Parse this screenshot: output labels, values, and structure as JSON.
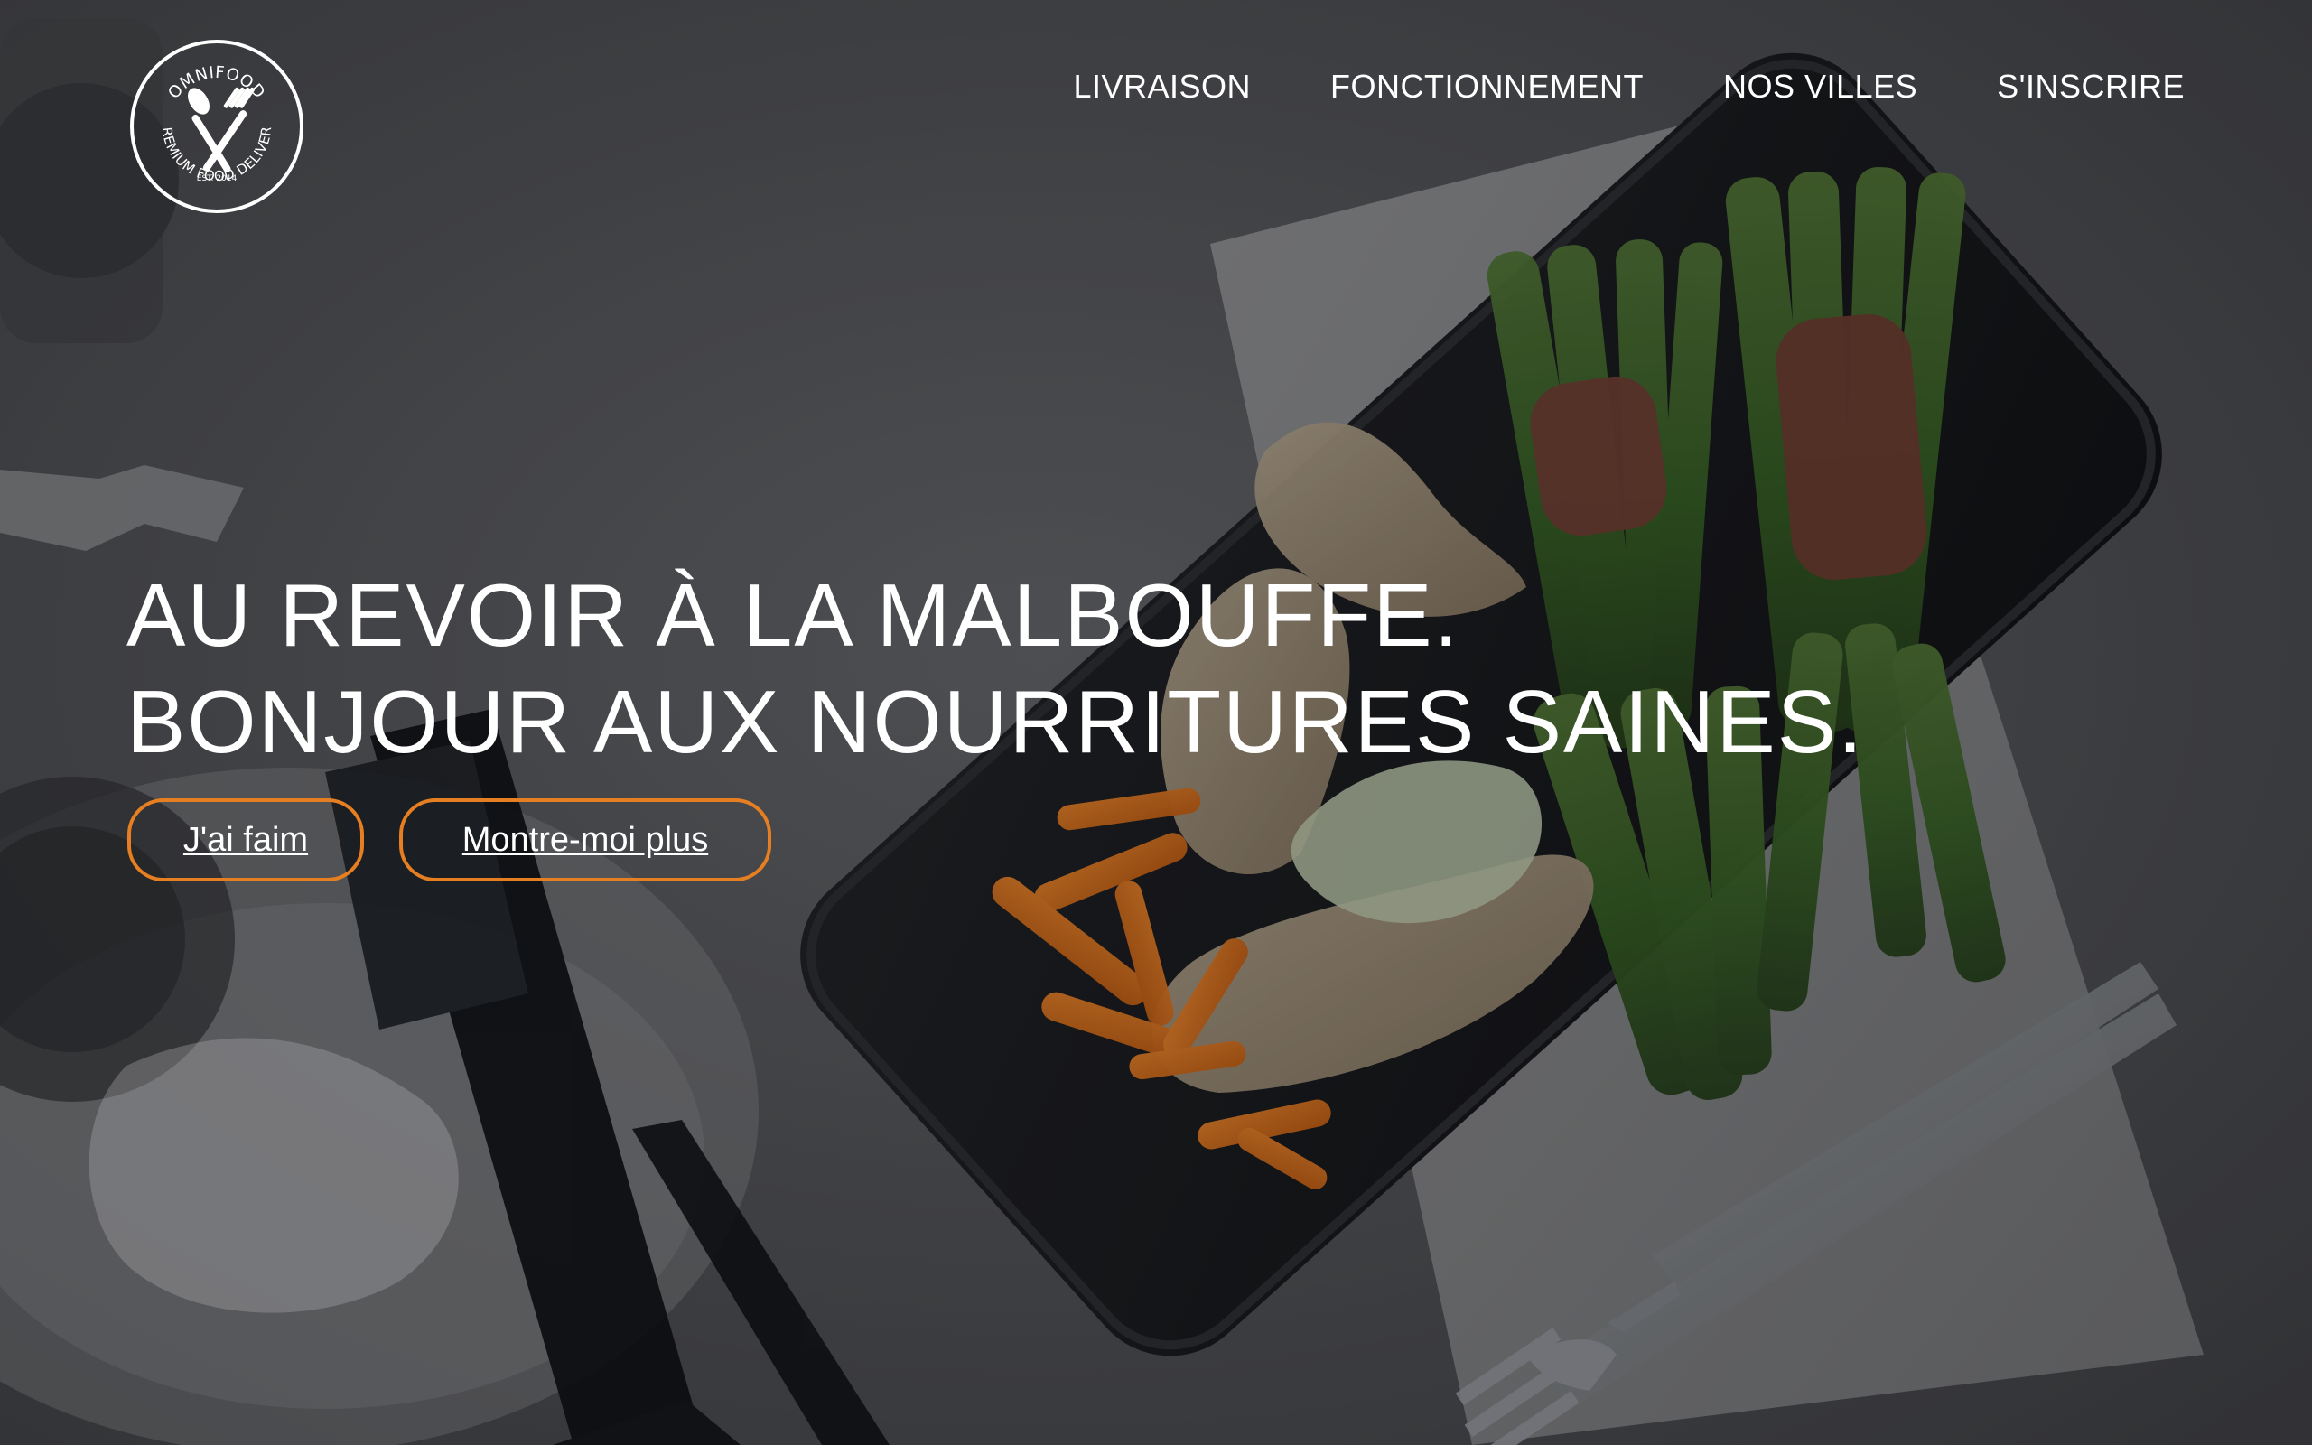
{
  "logo": {
    "top_text": "OMNIFOOD",
    "est_text": "EST. 2014",
    "bottom_text": "PREMIUM FOOD DELIVERY",
    "icon": "spoon-fork-icon"
  },
  "nav": {
    "items": [
      {
        "label": "LIVRAISON"
      },
      {
        "label": "FONCTIONNEMENT"
      },
      {
        "label": "NOS VILLES"
      },
      {
        "label": "S'INSCRIRE"
      }
    ]
  },
  "hero": {
    "headline_line1": "AU REVOIR À LA MALBOUFFE.",
    "headline_line2": "BONJOUR AUX NOURRITURES SAINES.",
    "button_hungry": "J'ai faim",
    "button_more": "Montre-moi plus",
    "background_image": "healthy-meal-plate-photo"
  },
  "colors": {
    "accent": "#e67e22",
    "text": "#ffffff",
    "overlay": "#000000"
  }
}
